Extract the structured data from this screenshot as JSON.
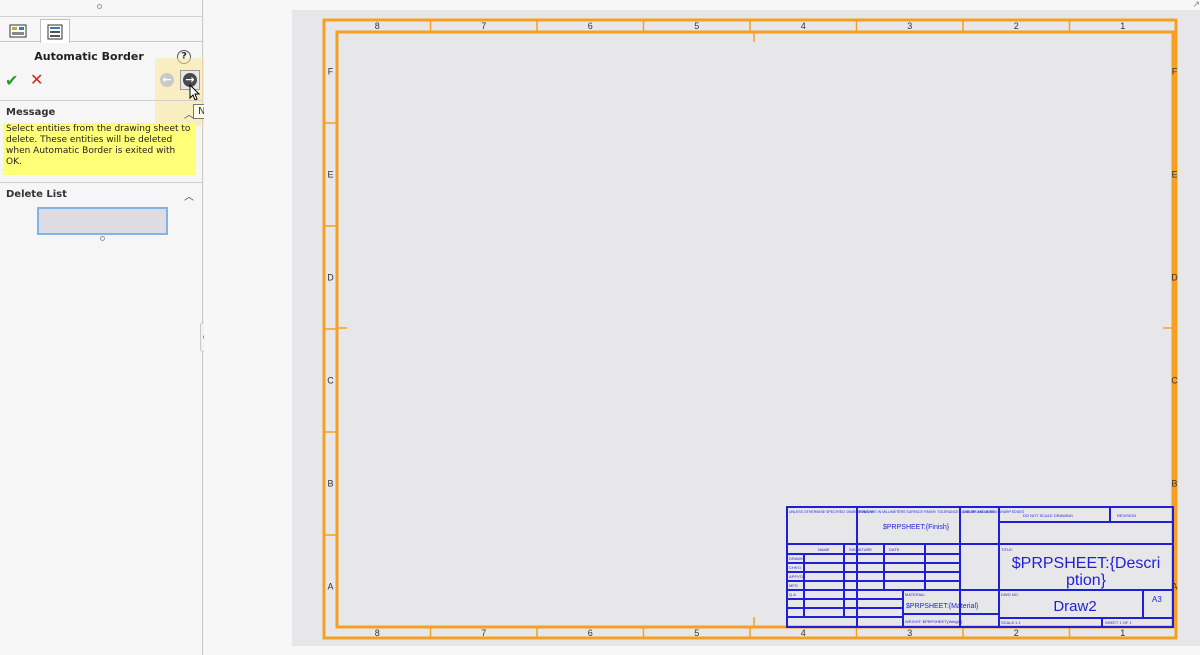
{
  "panel": {
    "title": "Automatic Border",
    "help_icon": "question-mark-icon",
    "ok_icon": "checkmark-icon",
    "cancel_icon": "x-icon",
    "tooltip": "Next",
    "message_header": "Message",
    "message_text": "Select entities from the drawing sheet to delete. These entities will be deleted when Automatic Border is exited with OK.",
    "delete_list_header": "Delete List",
    "colors": {
      "message_bg": "#ffff78",
      "highlight": "#fae896",
      "list_border": "#7fb5e6"
    }
  },
  "sheet": {
    "border_color": "#f5a022",
    "titleblock_color": "#1f1fd8",
    "zone_columns_top": [
      "8",
      "7",
      "6",
      "5",
      "4",
      "3",
      "2",
      "1"
    ],
    "zone_columns_bottom": [
      "8",
      "7",
      "6",
      "5",
      "4",
      "3",
      "2",
      "1"
    ],
    "zone_rows": [
      "F",
      "E",
      "D",
      "C",
      "B",
      "A"
    ],
    "title_block": {
      "finish_label": "FINISH:",
      "finish_value": "$PRPSHEET:{Finish}",
      "dims_note": "UNLESS OTHERWISE SPECIFIED: DIMENSIONS ARE IN MILLIMETERS SURFACE FINISH: TOLERANCES: LINEAR: ANGULAR:",
      "deburr_note": "DEBURR AND BREAK SHARP EDGES",
      "no_scale_note": "DO NOT SCALE DRAWING",
      "revision_label": "REVISION",
      "col_name": "NAME",
      "col_signature": "SIGNATURE",
      "col_date": "DATE",
      "row_labels": [
        "DRAWN",
        "CHK'D",
        "APPV'D",
        "MFG",
        "Q.A"
      ],
      "title_label": "TITLE:",
      "description": "$PRPSHEET:{Description}",
      "description_line1": "$PRPSHEET:{Descri",
      "description_line2": "ption}",
      "material_label": "MATERIAL:",
      "material_value": "$PRPSHEET:{Material}",
      "dwg_no_label": "DWG NO.",
      "dwg_no": "Draw2",
      "size": "A3",
      "weight_label": "WEIGHT: $PRPSHEET:{Weight}",
      "scale_label": "SCALE:1:1",
      "sheet_label": "SHEET 1 OF 1"
    }
  }
}
